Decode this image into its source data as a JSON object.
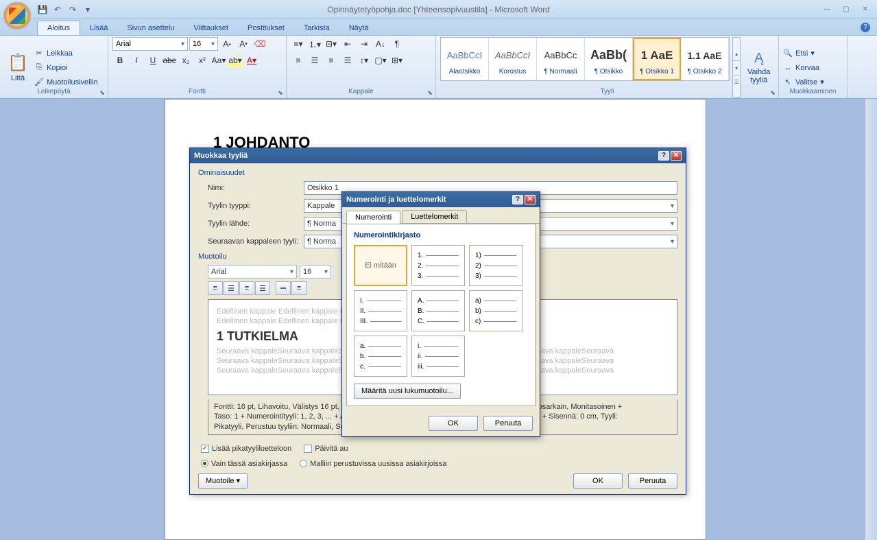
{
  "title": "Opinnäytetyöpohja.doc [Yhteensopivuustila] - Microsoft Word",
  "ribbon_tabs": [
    "Aloitus",
    "Lisää",
    "Sivun asettelu",
    "Viittaukset",
    "Postitukset",
    "Tarkista",
    "Näytä"
  ],
  "clipboard": {
    "paste": "Liitä",
    "cut": "Leikkaa",
    "copy": "Kopioi",
    "painter": "Muotoilusivellin",
    "label": "Leikepöytä"
  },
  "font": {
    "name": "Arial",
    "size": "16",
    "label": "Fontti"
  },
  "paragraph": {
    "label": "Kappale"
  },
  "styles": {
    "label": "Tyyli",
    "change": "Vaihda tyyliä",
    "items": [
      {
        "preview": "AaBbCcI",
        "name": "Alaotsikko"
      },
      {
        "preview": "AaBbCcI",
        "name": "Korostus"
      },
      {
        "preview": "AaBbCc",
        "name": "¶ Normaali"
      },
      {
        "preview": "AaBb(",
        "name": "¶ Otsikko"
      },
      {
        "preview": "1  AaE",
        "name": "¶ Otsikko 1"
      },
      {
        "preview": "1.1 AaE",
        "name": "¶ Otsikko 2"
      }
    ]
  },
  "editing": {
    "find": "Etsi",
    "replace": "Korvaa",
    "select": "Valitse",
    "label": "Muokkaaminen"
  },
  "document": {
    "heading": "1  JOHDANTO"
  },
  "modify": {
    "title": "Muokkaa tyyliä",
    "props": "Ominaisuudet",
    "name_label": "Nimi:",
    "name_value": "Otsikko 1",
    "type_label": "Tyylin tyyppi:",
    "type_value": "Kappale",
    "based_label": "Tyylin lähde:",
    "based_value": "¶ Norma",
    "next_label": "Seuraavan kappaleen tyyli:",
    "next_value": "¶ Norma",
    "formatting": "Muotoilu",
    "font": "Arial",
    "size": "16",
    "prev_para": "Edellinen kappale Edellinen kappale Edellinen kappale Edellinen kappale",
    "sample": "1  TUTKIELMA",
    "next_para": "Seuraava kappaleSeuraava kappaleSeuraava kappaleSeuraava kappaleSeuraava kappaleSeuraava kappaleSeuraava",
    "desc1": "Fontti: 16 pt, Lihavoitu, Välistys 16 pt, Välike edelle: 12 pt, Rivitys: 1,5, Sarkaimet: 0,7 cm, Luettelosarkain, Monitasoinen +",
    "desc2": "Taso: 1 + Numerointityyli: 1, 2, 3, ... + Aloitusnumero: 1 + Tasaus: Vasen + Tasauskohteen: 0,7 cm + Sisennä: 0 cm, Tyyli:",
    "desc3": "Pikatyyli, Perustuu tyyliin: Normaali, Seuraavan kappaleen tyyli: Normaali",
    "add_quick": "Lisää pikatyyliluetteloon",
    "auto_update": "Päivitä au",
    "only_doc": "Vain tässä asiakirjassa",
    "new_docs": "Malliin perustuvissa uusissa asiakirjoissa",
    "format_btn": "Muotoile",
    "ok": "OK",
    "cancel": "Peruuta"
  },
  "numbering": {
    "title": "Numerointi ja luettelomerkit",
    "tab1": "Numerointi",
    "tab2": "Luettelomerkit",
    "library": "Numerointikirjasto",
    "none": "Ei mitään",
    "cells": [
      [
        "1.",
        "2.",
        "3."
      ],
      [
        "1)",
        "2)",
        "3)"
      ],
      [
        "I.",
        "II.",
        "III."
      ],
      [
        "A.",
        "B.",
        "C."
      ],
      [
        "a)",
        "b)",
        "c)"
      ],
      [
        "a.",
        "b.",
        "c."
      ],
      [
        "i.",
        "ii.",
        "iii."
      ]
    ],
    "define": "Määritä uusi lukumuotoilu...",
    "ok": "OK",
    "cancel": "Peruuta"
  }
}
